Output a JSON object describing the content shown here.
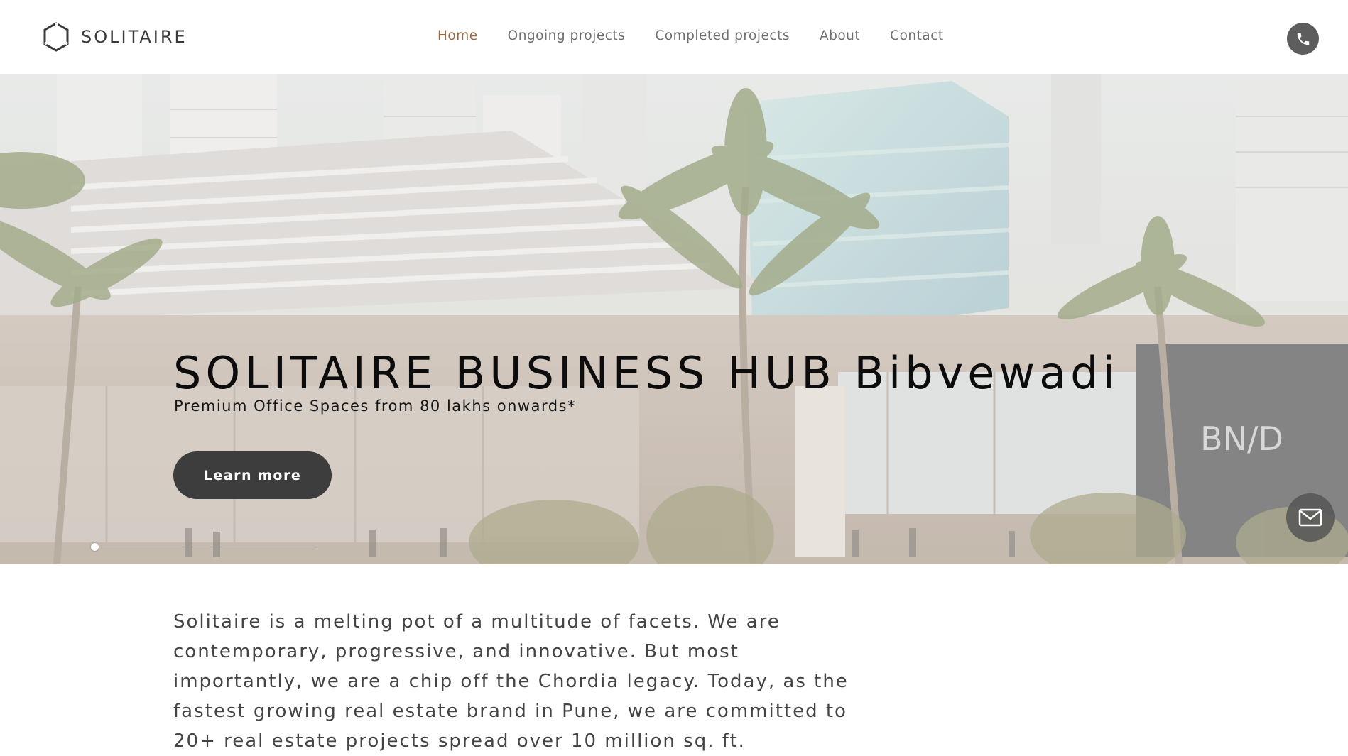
{
  "brand": {
    "name": "SOLITAIRE",
    "logo_icon": "hexagon-logo-icon"
  },
  "nav": {
    "items": [
      {
        "label": "Home",
        "active": true
      },
      {
        "label": "Ongoing projects",
        "active": false
      },
      {
        "label": "Completed projects",
        "active": false
      },
      {
        "label": "About",
        "active": false
      },
      {
        "label": "Contact",
        "active": false
      }
    ]
  },
  "header": {
    "phone_icon": "phone-icon"
  },
  "hero": {
    "title": "SOLITAIRE BUSINESS HUB Bibvewadi",
    "subtitle": "Premium Office Spaces from 80 lakhs onwards*",
    "cta_label": "Learn more",
    "mail_icon": "envelope-icon"
  },
  "intro": {
    "text": "Solitaire is a melting pot of a multitude of facets. We are contemporary, progressive, and innovative. But most importantly, we are a chip off the Chordia legacy. Today, as the fastest growing real estate brand in Pune, we are committed to 20+ real estate projects spread over 10 million sq. ft."
  },
  "colors": {
    "accent_active_nav": "#9a6a45",
    "button_dark": "#3d3d3d",
    "icon_button": "#5d5d5d"
  }
}
